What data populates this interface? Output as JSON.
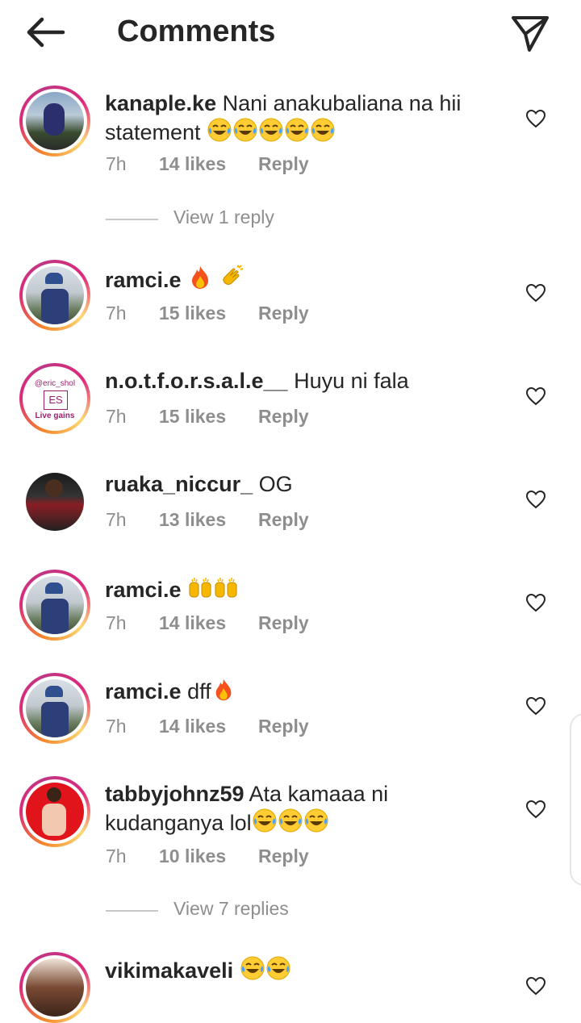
{
  "header": {
    "title": "Comments"
  },
  "comments": [
    {
      "user": "kanaple.ke",
      "text": "Nani anakubaliana na hii statement",
      "time": "7h",
      "likes": "14 likes",
      "reply": "Reply"
    },
    {
      "user": "ramci.e",
      "text": "",
      "time": "7h",
      "likes": "15 likes",
      "reply": "Reply"
    },
    {
      "user": "n.o.t.f.o.r.s.a.l.e__",
      "text": "Huyu ni fala",
      "time": "7h",
      "likes": "15 likes",
      "reply": "Reply"
    },
    {
      "user": "ruaka_niccur_",
      "text": "OG",
      "time": "7h",
      "likes": "13 likes",
      "reply": "Reply"
    },
    {
      "user": "ramci.e",
      "text": "",
      "time": "7h",
      "likes": "14 likes",
      "reply": "Reply"
    },
    {
      "user": "ramci.e",
      "text": "dff",
      "time": "7h",
      "likes": "14 likes",
      "reply": "Reply"
    },
    {
      "user": "tabbyjohnz59",
      "text": "Ata kamaaa ni kudanganya lol",
      "time": "7h",
      "likes": "10 likes",
      "reply": "Reply"
    },
    {
      "user": "vikimakaveli",
      "text": ""
    }
  ],
  "view_replies": [
    "View 1 reply",
    "View 7 replies"
  ],
  "avatar3_lines": [
    "@eric_shol",
    "ES",
    "Live gains"
  ],
  "colors": {
    "text": "#262626",
    "meta": "#8e8e8e",
    "ring_start": "#f58529",
    "ring_end": "#dd2a7b"
  },
  "icons": [
    "back-arrow-icon",
    "send-icon",
    "heart-icon",
    "tears-of-joy-emoji",
    "fire-emoji",
    "clapping-emoji",
    "raising-hands-emoji"
  ]
}
